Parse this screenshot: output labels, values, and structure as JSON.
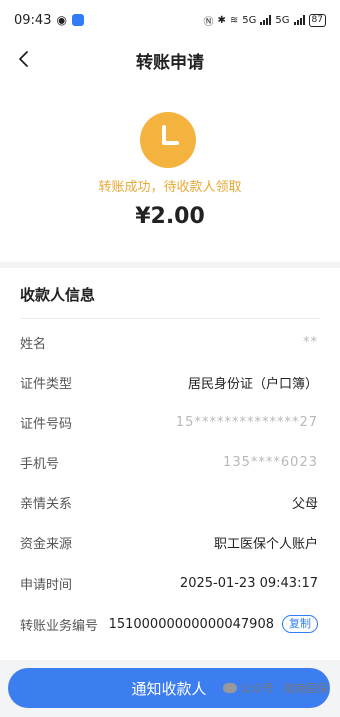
{
  "status_bar": {
    "time": "09:43",
    "network": "5G",
    "network2": "5G",
    "battery": "87"
  },
  "header": {
    "title": "转账申请"
  },
  "hero": {
    "status_text": "转账成功，待收款人领取",
    "amount": "¥2.00",
    "accent_color": "#f4b23e"
  },
  "card": {
    "title": "收款人信息",
    "rows": [
      {
        "label": "姓名",
        "value": "**"
      },
      {
        "label": "证件类型",
        "value": "居民身份证（户口簿）"
      },
      {
        "label": "证件号码",
        "value": "15**************27"
      },
      {
        "label": "手机号",
        "value": "135****6023"
      },
      {
        "label": "亲情关系",
        "value": "父母"
      },
      {
        "label": "资金来源",
        "value": "职工医保个人账户"
      },
      {
        "label": "申请时间",
        "value": "2025-01-23 09:43:17"
      },
      {
        "label": "转账业务编号",
        "value": "15100000000000047908",
        "action": "复制"
      }
    ]
  },
  "footer": {
    "button_label": "通知收款人",
    "button_color": "#3c7df0"
  },
  "watermark": {
    "text": "公众号 · 陇南医保"
  }
}
